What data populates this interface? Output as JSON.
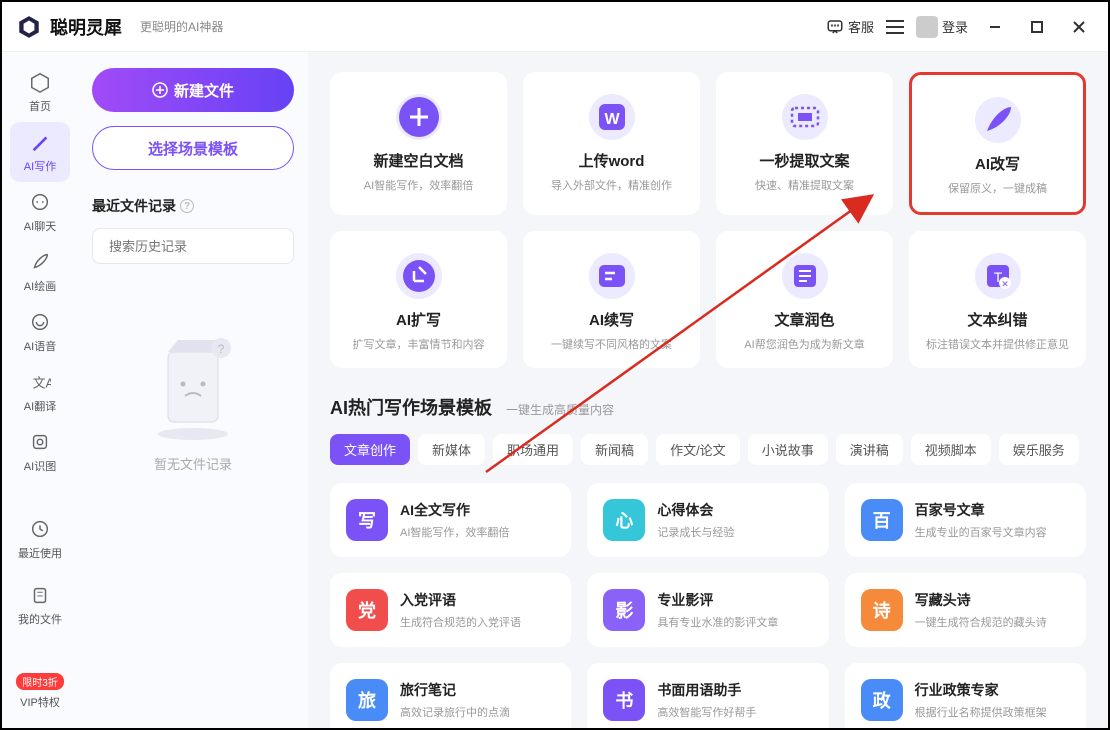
{
  "header": {
    "app_name": "聪明灵犀",
    "slogan": "更聪明的AI神器",
    "kefu": "客服",
    "login": "登录"
  },
  "sidebar": {
    "items": [
      {
        "label": "首页",
        "icon": "home"
      },
      {
        "label": "AI写作",
        "icon": "pen",
        "active": true
      },
      {
        "label": "AI聊天",
        "icon": "chat"
      },
      {
        "label": "AI绘画",
        "icon": "brush"
      },
      {
        "label": "AI语音",
        "icon": "voice"
      },
      {
        "label": "AI翻译",
        "icon": "translate"
      },
      {
        "label": "AI识图",
        "icon": "scan"
      }
    ],
    "bottom": [
      {
        "label": "最近使用",
        "icon": "clock"
      },
      {
        "label": "我的文件",
        "icon": "files"
      },
      {
        "label": "VIP特权",
        "icon": "vip",
        "badge": "限时3折"
      }
    ]
  },
  "panel": {
    "new_file": "新建文件",
    "select_template": "选择场景模板",
    "recent_header": "最近文件记录",
    "search_placeholder": "搜索历史记录",
    "empty_text": "暂无文件记录"
  },
  "cards": {
    "row1": [
      {
        "title": "新建空白文档",
        "desc": "AI智能写作，效率翻倍",
        "icon": "plus"
      },
      {
        "title": "上传word",
        "desc": "导入外部文件，精准创作",
        "icon": "word"
      },
      {
        "title": "一秒提取文案",
        "desc": "快速、精准提取文案",
        "icon": "extract"
      },
      {
        "title": "AI改写",
        "desc": "保留原义，一键成稿",
        "icon": "feather",
        "highlight": true
      }
    ],
    "row2": [
      {
        "title": "AI扩写",
        "desc": "扩写文章，丰富情节和内容",
        "icon": "expand"
      },
      {
        "title": "AI续写",
        "desc": "一键续写不同风格的文案",
        "icon": "continue"
      },
      {
        "title": "文章润色",
        "desc": "AI帮您润色为成为新文章",
        "icon": "polish"
      },
      {
        "title": "文本纠错",
        "desc": "标注错误文本并提供修正意见",
        "icon": "correct"
      }
    ]
  },
  "section": {
    "title": "AI热门写作场景模板",
    "subtitle": "一键生成高质量内容"
  },
  "tabs": [
    "文章创作",
    "新媒体",
    "职场通用",
    "新闻稿",
    "作文/论文",
    "小说故事",
    "演讲稿",
    "视频脚本",
    "娱乐服务"
  ],
  "templates": [
    {
      "title": "AI全文写作",
      "desc": "AI智能写作，效率翻倍",
      "color": "#7a52f6",
      "glyph": "写"
    },
    {
      "title": "心得体会",
      "desc": "记录成长与经验",
      "color": "#35c6d9",
      "glyph": "心"
    },
    {
      "title": "百家号文章",
      "desc": "生成专业的百家号文章内容",
      "color": "#4a8cf7",
      "glyph": "百"
    },
    {
      "title": "入党评语",
      "desc": "生成符合规范的入党评语",
      "color": "#f24d4d",
      "glyph": "党"
    },
    {
      "title": "专业影评",
      "desc": "具有专业水准的影评文章",
      "color": "#8a62f7",
      "glyph": "影"
    },
    {
      "title": "写藏头诗",
      "desc": "一键生成符合规范的藏头诗",
      "color": "#f58b3a",
      "glyph": "诗"
    },
    {
      "title": "旅行笔记",
      "desc": "高效记录旅行中的点滴",
      "color": "#4a8cf7",
      "glyph": "旅"
    },
    {
      "title": "书面用语助手",
      "desc": "高效智能写作好帮手",
      "color": "#7a52f6",
      "glyph": "书"
    },
    {
      "title": "行业政策专家",
      "desc": "根据行业名称提供政策框架",
      "color": "#4a8cf7",
      "glyph": "政"
    }
  ]
}
